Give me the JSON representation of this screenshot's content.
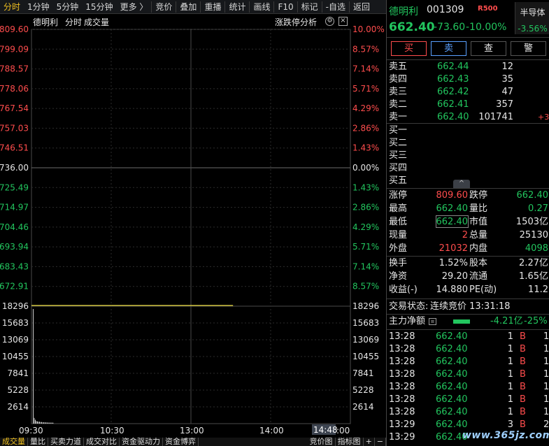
{
  "toolbar": {
    "items": [
      "分时",
      "1分钟",
      "5分钟",
      "15分钟",
      "更多 〉",
      "竞价",
      "叠加",
      "重播",
      "统计",
      "画线",
      "F10",
      "标记",
      "-自选",
      "返回"
    ]
  },
  "chart": {
    "header_left": [
      "德明利",
      "分时",
      "成交量"
    ],
    "header_right": "涨跌停分析",
    "price_ticks_left": [
      "809.60",
      "799.09",
      "788.57",
      "778.06",
      "767.54",
      "757.03",
      "746.51",
      "736.00",
      "725.49",
      "714.97",
      "704.46",
      "693.94",
      "683.43",
      "672.91"
    ],
    "pct_ticks_right": [
      "10.00%",
      "8.57%",
      "7.14%",
      "5.71%",
      "4.29%",
      "2.86%",
      "1.43%",
      "0.00%",
      "1.43%",
      "2.86%",
      "4.29%",
      "5.71%",
      "7.14%",
      "8.57%"
    ],
    "vol_ticks": [
      "18296",
      "15683",
      "13069",
      "10455",
      "7841",
      "5228",
      "2614"
    ],
    "time_labels": [
      "09:30",
      "10:30",
      "13:00",
      "14:00",
      "14:48",
      ":00"
    ],
    "colors": {
      "up": "#ff4d4d",
      "down": "#22c55e",
      "flat": "#e6e6e6",
      "price_line": "#f0e040"
    }
  },
  "chart_data": {
    "type": "line",
    "x_labels": [
      "09:30",
      "10:30",
      "13:00",
      "14:00"
    ],
    "price_axis": [
      672.91,
      809.6
    ],
    "prev_close": 736.0,
    "series": [
      {
        "values": [
          662.4,
          662.4,
          662.4,
          662.4
        ]
      }
    ],
    "volume_axis": [
      0,
      18296
    ],
    "volume": [
      101741,
      900,
      600,
      400,
      350,
      300,
      300,
      250,
      250,
      200,
      200,
      200,
      180,
      180,
      160,
      160,
      150,
      150,
      150,
      140
    ]
  },
  "bottom_tabs": [
    "成交量",
    "量比",
    "买卖力道",
    "成交对比",
    "资金驱动力",
    "资金博弈",
    "竞价图",
    "指标图",
    "+",
    "−"
  ],
  "quote": {
    "name": "德明利",
    "code": "001309",
    "badge": "R500",
    "sector_name": "半导体",
    "sector_pct": "-3.56%",
    "price": "662.40",
    "change": "-73.60",
    "change_pct": "-10.00%",
    "actions": [
      "买",
      "卖",
      "查",
      "警"
    ],
    "asks": [
      {
        "label": "卖五",
        "price": "662.44",
        "vol": "12",
        "extra": ""
      },
      {
        "label": "卖四",
        "price": "662.43",
        "vol": "35",
        "extra": ""
      },
      {
        "label": "卖三",
        "price": "662.42",
        "vol": "47",
        "extra": ""
      },
      {
        "label": "卖二",
        "price": "662.41",
        "vol": "357",
        "extra": ""
      },
      {
        "label": "卖一",
        "price": "662.40",
        "vol": "101741",
        "extra": "+3"
      }
    ],
    "bids": [
      {
        "label": "买一"
      },
      {
        "label": "买二"
      },
      {
        "label": "买三"
      },
      {
        "label": "买四"
      },
      {
        "label": "买五"
      }
    ],
    "collapse_glyph": "^",
    "stats": [
      {
        "l1": "涨停",
        "v1": "809.60",
        "c1": "r",
        "l2": "跌停",
        "v2": "662.40",
        "c2": "g"
      },
      {
        "l1": "最高",
        "v1": "662.40",
        "c1": "g",
        "l2": "量比",
        "v2": "0.27",
        "c2": "g"
      },
      {
        "l1": "最低",
        "v1": "662.40",
        "c1": "g",
        "l2": "市值",
        "v2": "1503亿",
        "c2": "w"
      },
      {
        "l1": "现量",
        "v1": "2",
        "c1": "r",
        "l2": "总量",
        "v2": "25130",
        "c2": "w"
      },
      {
        "l1": "外盘",
        "v1": "21032",
        "c1": "r",
        "l2": "内盘",
        "v2": "4098",
        "c2": "g"
      }
    ],
    "stats2": [
      {
        "l1": "换手",
        "v1": "1.52%",
        "l2": "股本",
        "v2": "2.27亿"
      },
      {
        "l1": "净资",
        "v1": "29.20",
        "l2": "流通",
        "v2": "1.65亿"
      },
      {
        "l1": "收益(-)",
        "v1": "14.880",
        "l2": "PE(动)",
        "v2": "11.2"
      }
    ],
    "trade_status_label": "交易状态:",
    "trade_status": "连续竞价 13:31:18",
    "main_flow_label": "主力净额",
    "main_flow_value": "-4.21亿",
    "main_flow_pct": "-25%",
    "ticks": [
      {
        "time": "13:28",
        "price": "662.40",
        "vol": "1",
        "side": "B",
        "n": "1"
      },
      {
        "time": "13:28",
        "price": "662.40",
        "vol": "1",
        "side": "B",
        "n": "1"
      },
      {
        "time": "13:28",
        "price": "662.40",
        "vol": "1",
        "side": "B",
        "n": "1"
      },
      {
        "time": "13:28",
        "price": "662.40",
        "vol": "1",
        "side": "B",
        "n": "1"
      },
      {
        "time": "13:28",
        "price": "662.40",
        "vol": "1",
        "side": "B",
        "n": "1"
      },
      {
        "time": "13:28",
        "price": "662.40",
        "vol": "1",
        "side": "B",
        "n": "1"
      },
      {
        "time": "13:28",
        "price": "662.40",
        "vol": "1",
        "side": "B",
        "n": "1"
      },
      {
        "time": "13:29",
        "price": "662.40",
        "vol": "3",
        "side": "B",
        "n": "2"
      },
      {
        "time": "13:29",
        "price": "662.40",
        "vol": "",
        "side": "",
        "n": ""
      }
    ],
    "watermark": "www.365jz.com"
  }
}
